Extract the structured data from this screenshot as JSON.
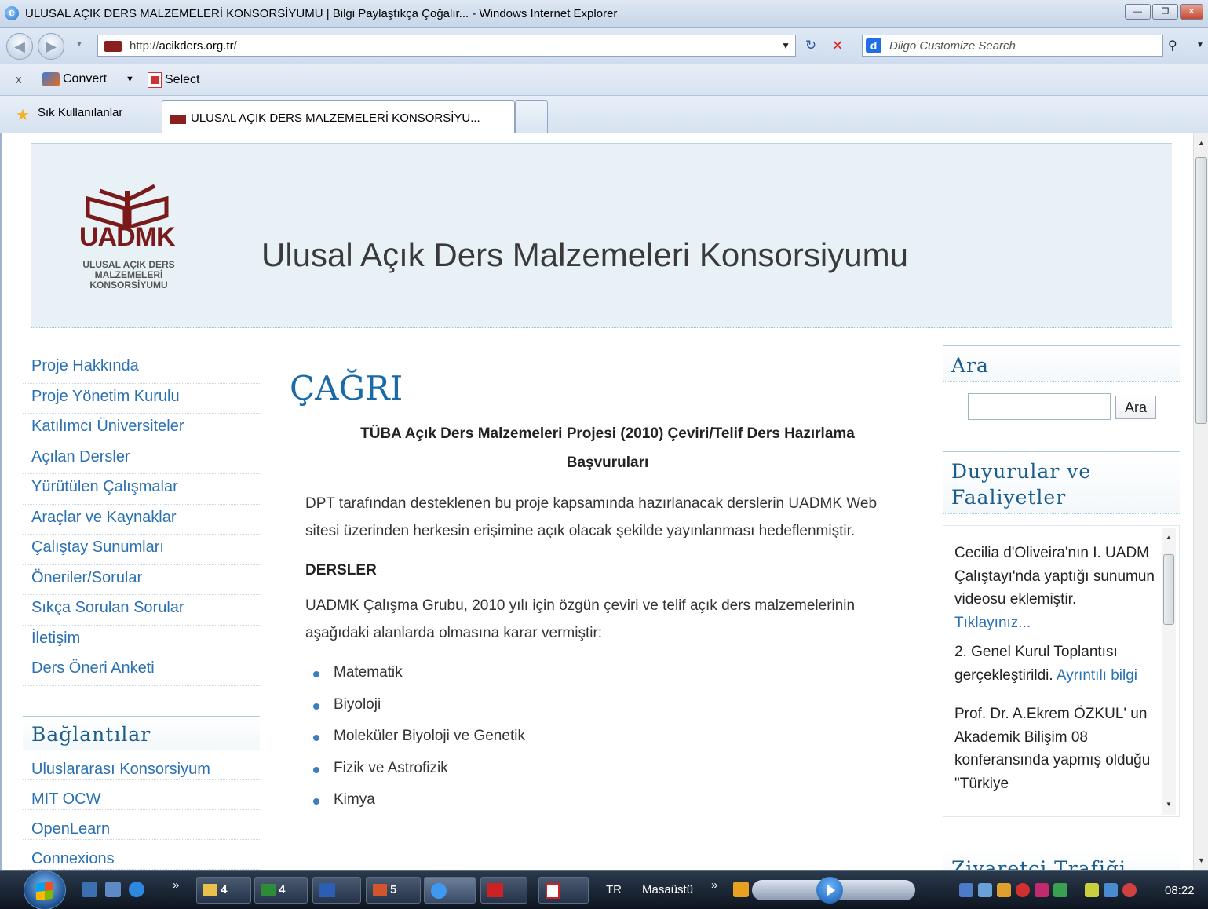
{
  "window": {
    "title": "ULUSAL AÇIK DERS MALZEMELERİ KONSORSİYUMU | Bilgi Paylaştıkça Çoğalır... - Windows Internet Explorer"
  },
  "address": {
    "url_prefix": "http://",
    "url_domain": "acikders.org.tr",
    "url_suffix": "/"
  },
  "search": {
    "placeholder": "Diigo Customize Search"
  },
  "commandbar": {
    "close": "x",
    "convert": "Convert",
    "select": "Select"
  },
  "favorites": {
    "label": "Sık Kullanılanlar"
  },
  "tabs": [
    {
      "label": "ULUSAL AÇIK DERS MALZEMELERİ KONSORSİYU..."
    }
  ],
  "header": {
    "logo_mark": "UADMK",
    "logo_sub": [
      "ULUSAL AÇIK DERS",
      "MALZEMELERİ",
      "KONSORSİYUMU"
    ],
    "site_title": "Ulusal Açık Ders Malzemeleri Konsorsiyumu"
  },
  "nav": [
    "Proje Hakkında",
    "Proje Yönetim Kurulu",
    "Katılımcı Üniversiteler",
    "Açılan Dersler",
    "Yürütülen Çalışmalar",
    "Araçlar ve Kaynaklar",
    "Çalıştay Sunumları",
    "Öneriler/Sorular",
    "Sıkça Sorulan Sorular",
    "İletişim",
    "Ders Öneri Anketi"
  ],
  "links": {
    "heading": "Bağlantılar",
    "items": [
      "Uluslararası Konsorsiyum",
      "MIT OCW",
      "OpenLearn",
      "Connexions"
    ]
  },
  "main": {
    "title": "ÇAĞRI",
    "subtitle_line1": "TÜBA Açık Ders Malzemeleri Projesi (2010) Çeviri/Telif Ders Hazırlama",
    "subtitle_line2": "Başvuruları",
    "intro": "DPT tarafından desteklenen bu proje kapsamında hazırlanacak derslerin UADMK Web sitesi üzerinden herkesin erişimine açık olacak şekilde yayınlanması hedeflenmiştir.",
    "section": "DERSLER",
    "section_text": "UADMK Çalışma Grubu, 2010 yılı için özgün çeviri ve telif açık ders malzemelerinin aşağıdaki alanlarda olmasına karar vermiştir:",
    "subjects": [
      "Matematik",
      "Biyoloji",
      "Moleküler Biyoloji ve Genetik",
      "Fizik ve Astrofizik",
      "Kimya"
    ]
  },
  "sidebar": {
    "search_heading": "Ara",
    "search_button": "Ara",
    "news_heading": "Duyurular ve Faaliyetler",
    "news": [
      {
        "text": "Cecilia d'Oliveira'nın I. UADM Çalıştayı'nda yaptığı sunumun videosu eklemiştir.",
        "link": "Tıklayınız..."
      },
      {
        "text": "2. Genel Kurul Toplantısı gerçekleştirildi.",
        "link": "Ayrıntılı bilgi"
      },
      {
        "text": "Prof. Dr. A.Ekrem ÖZKUL' un Akademik Bilişim 08 konferansında yapmış olduğu \"Türkiye",
        "link": ""
      }
    ],
    "traffic_heading": "Ziyaretçi Trafiği"
  },
  "taskbar": {
    "chevron": "»",
    "buttons": [
      "4",
      "4",
      "",
      "5",
      "",
      "",
      ""
    ],
    "lang": "TR",
    "desktop": "Masaüstü",
    "clock": "08:22"
  }
}
